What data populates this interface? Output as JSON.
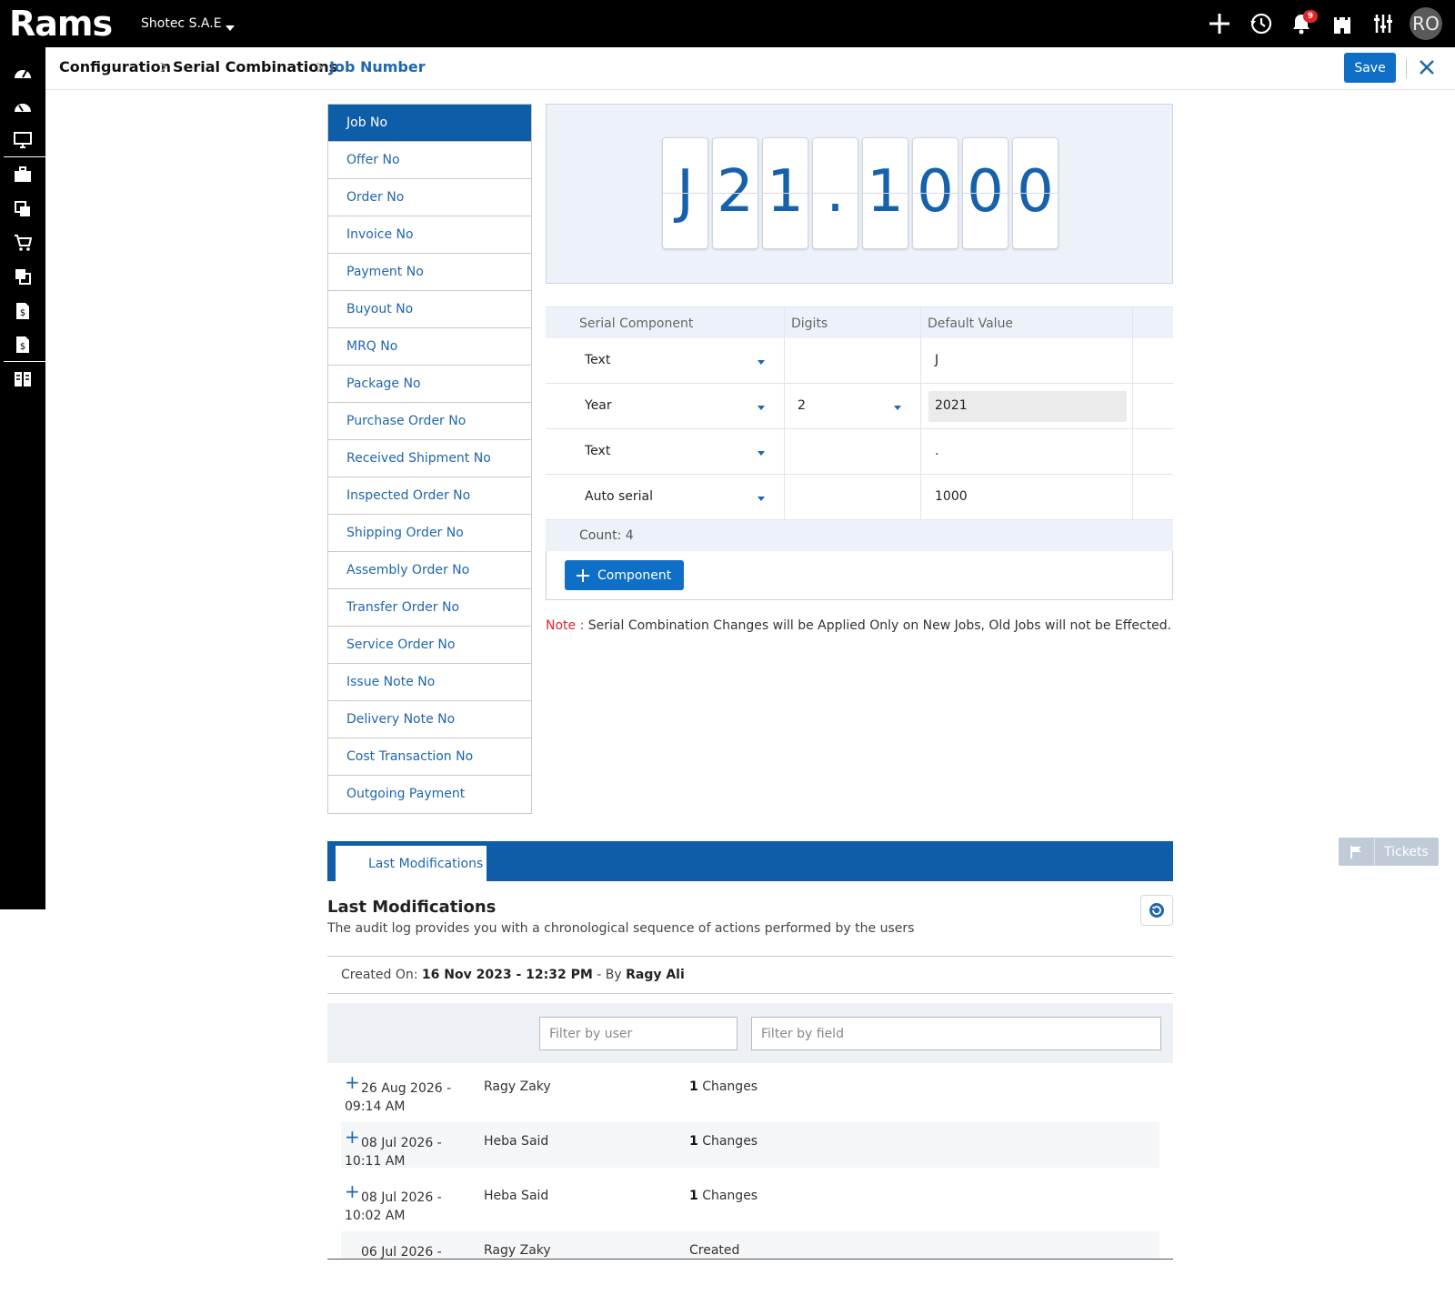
{
  "app": {
    "logo": "Rams",
    "company": "Shotec S.A.E",
    "notification_count": "9",
    "avatar_initials": "RO"
  },
  "breadcrumb": {
    "items": [
      "Configuration",
      "Serial Combinations"
    ],
    "current": "Job Number"
  },
  "actions": {
    "save_label": "Save"
  },
  "serial_types": [
    "Job No",
    "Offer No",
    "Order No",
    "Invoice No",
    "Payment No",
    "Buyout No",
    "MRQ No",
    "Package No",
    "Purchase Order No",
    "Received Shipment No",
    "Inspected Order No",
    "Shipping Order No",
    "Assembly Order No",
    "Transfer Order No",
    "Service Order No",
    "Issue Note No",
    "Delivery Note No",
    "Cost Transaction No",
    "Outgoing Payment"
  ],
  "selected_serial": "Job No",
  "preview": {
    "chars": [
      "J",
      "2",
      "1",
      ".",
      "1",
      "0",
      "0",
      "0"
    ]
  },
  "components_table": {
    "headers": [
      "Serial Component",
      "Digits",
      "Default Value"
    ],
    "rows": [
      {
        "component": "Text",
        "digits": "",
        "default": "J"
      },
      {
        "component": "Year",
        "digits": "2",
        "default": "2021"
      },
      {
        "component": "Text",
        "digits": "",
        "default": "."
      },
      {
        "component": "Auto serial",
        "digits": "",
        "default": "1000"
      }
    ],
    "count_label": "Count: 4",
    "add_button": "Component"
  },
  "note": {
    "label": "Note",
    "separator": " : ",
    "text": "Serial Combination Changes will be Applied Only on New Jobs, Old Jobs will not be Effected."
  },
  "tickets_label": "Tickets",
  "tabs": [
    "Last Modifications"
  ],
  "last_modifications": {
    "title": "Last Modifications",
    "subtitle": "The audit log provides you with a chronological sequence of actions performed by the users",
    "created_prefix": "Created On:",
    "created_date": "16 Nov 2023 - 12:32 PM",
    "created_by_prefix": "- By",
    "created_by": "Ragy Ali",
    "filter_user_placeholder": "Filter by user",
    "filter_field_placeholder": "Filter by field",
    "entries": [
      {
        "date": "26 Aug 2026 - 09:14 AM",
        "user": "Ragy Zaky",
        "count": "1",
        "changes_label": "Changes",
        "expandable": true
      },
      {
        "date": "08 Jul 2026 - 10:11 AM",
        "user": "Heba Said",
        "count": "1",
        "changes_label": "Changes",
        "expandable": true
      },
      {
        "date": "08 Jul 2026 - 10:02 AM",
        "user": "Heba Said",
        "count": "1",
        "changes_label": "Changes",
        "expandable": true
      },
      {
        "date": "06 Jul 2026 -",
        "user": "Ragy Zaky",
        "count": "",
        "changes_label": "Created",
        "expandable": false
      }
    ]
  },
  "colors": {
    "brand_blue": "#0d5da8",
    "button_blue": "#0f6fc6",
    "link_blue": "#1f66ad",
    "note_red": "#e0262b",
    "preview_bg": "#edf2fa"
  }
}
